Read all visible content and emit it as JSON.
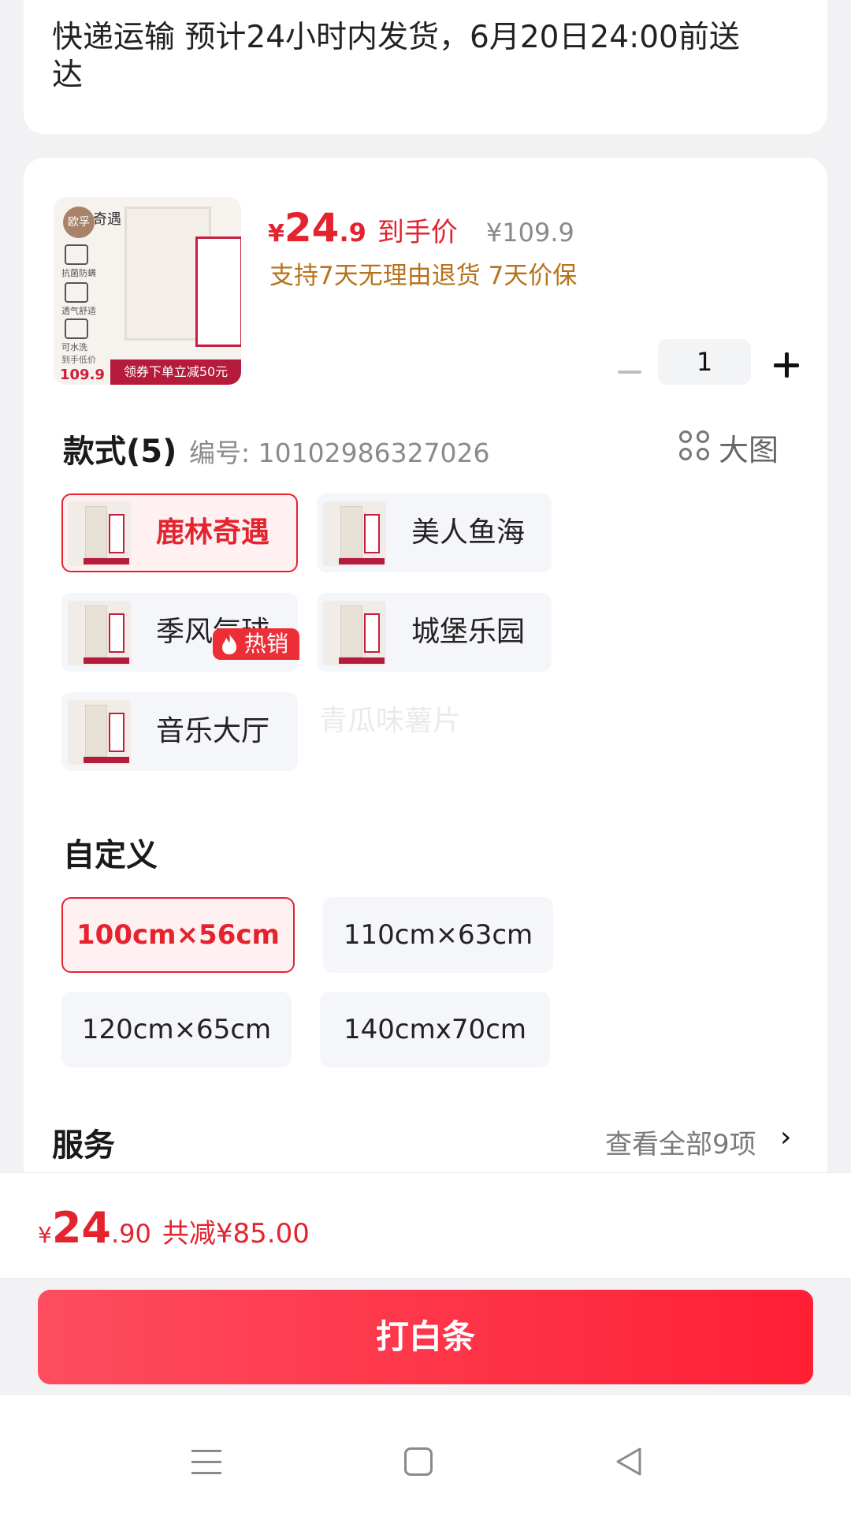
{
  "delivery": {
    "text": "快递运输 预计24小时内发货，6月20日24:00前送达"
  },
  "product": {
    "thumb": {
      "brand": "欧孚",
      "series_text": "奇遇",
      "icon_labels": [
        "抗菌防螨",
        "透气舒适",
        "可水洗"
      ],
      "price_label": "到手低价",
      "price": "109.9",
      "coupon_banner": "领券下单立减50元"
    },
    "price": {
      "currency": "¥",
      "int": "24",
      "dec": ".9",
      "label": "到手价",
      "original": "¥109.9"
    },
    "promise": "支持7天无理由退货  7天价保",
    "quantity": "1"
  },
  "style": {
    "title": "款式(5)",
    "sku": "编号: 10102986327026",
    "big_image_label": "大图",
    "hot_badge": "热销",
    "options": [
      {
        "label": "鹿林奇遇",
        "selected": true
      },
      {
        "label": "美人鱼海",
        "selected": false
      },
      {
        "label": "季风气球",
        "selected": false
      },
      {
        "label": "城堡乐园",
        "selected": false
      },
      {
        "label": "音乐大厅",
        "selected": false
      }
    ]
  },
  "watermark": "青瓜味薯片",
  "custom": {
    "title": "自定义",
    "options": [
      {
        "label": "100cm×56cm",
        "selected": true
      },
      {
        "label": "110cm×63cm",
        "selected": false
      },
      {
        "label": "120cm×65cm",
        "selected": false
      },
      {
        "label": "140cmx70cm",
        "selected": false
      }
    ]
  },
  "service": {
    "title": "服务",
    "link": "查看全部9项",
    "chevron": "›"
  },
  "total": {
    "currency": "¥",
    "int": "24",
    "dec": ".90",
    "discount": "共减¥85.00"
  },
  "pay_button": "打白条",
  "colors": {
    "accent": "#e4232f",
    "promise": "#b8721b",
    "selected_bg": "#fff0f1"
  },
  "icons": [
    "minus-icon",
    "plus-icon",
    "grid-icon",
    "flame-icon",
    "chevron-right-icon",
    "nav-menu-icon",
    "nav-home-icon",
    "nav-back-icon"
  ]
}
